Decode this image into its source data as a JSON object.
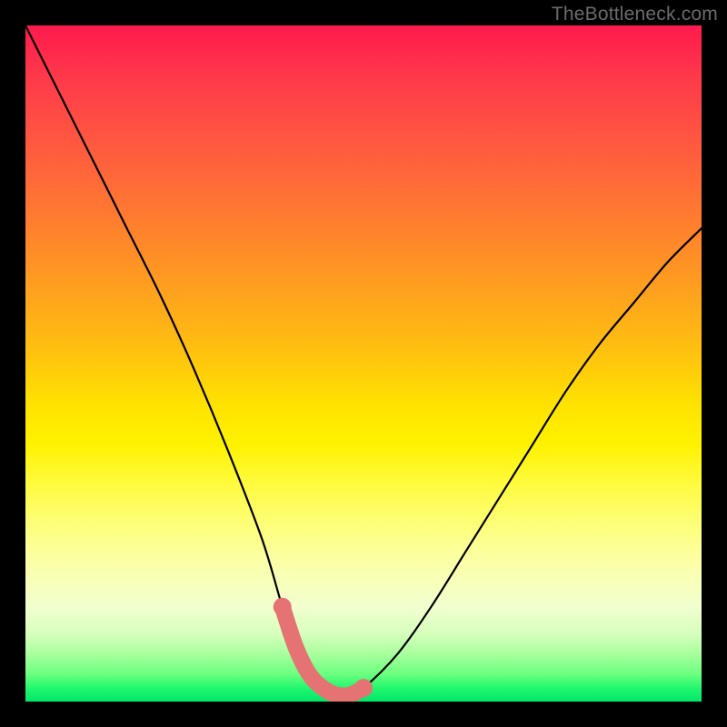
{
  "watermark": "TheBottleneck.com",
  "chart_data": {
    "type": "line",
    "title": "",
    "xlabel": "",
    "ylabel": "",
    "xlim": [
      0,
      100
    ],
    "ylim": [
      0,
      100
    ],
    "grid": false,
    "legend": false,
    "series": [
      {
        "name": "curve",
        "color": "#000000",
        "x": [
          0,
          5,
          10,
          15,
          20,
          25,
          30,
          35,
          38,
          40,
          42,
          44,
          46,
          48,
          50,
          55,
          60,
          65,
          70,
          75,
          80,
          85,
          90,
          95,
          100
        ],
        "values": [
          100,
          90,
          80,
          70,
          60,
          49,
          37,
          24,
          14,
          8,
          4,
          2,
          1,
          1,
          2,
          7,
          14,
          22,
          30,
          38,
          46,
          53,
          59,
          65,
          70
        ]
      },
      {
        "name": "valley-highlight",
        "color": "#e57373",
        "x": [
          38,
          40,
          42,
          44,
          46,
          48,
          50
        ],
        "values": [
          14,
          8,
          4,
          2,
          1,
          1,
          2
        ]
      }
    ],
    "background_gradient": {
      "direction": "top-to-bottom",
      "stops": [
        {
          "pos": 0.0,
          "color": "#ff1a4d"
        },
        {
          "pos": 0.5,
          "color": "#ffc010"
        },
        {
          "pos": 0.7,
          "color": "#fff200"
        },
        {
          "pos": 1.0,
          "color": "#00e86a"
        }
      ]
    }
  }
}
